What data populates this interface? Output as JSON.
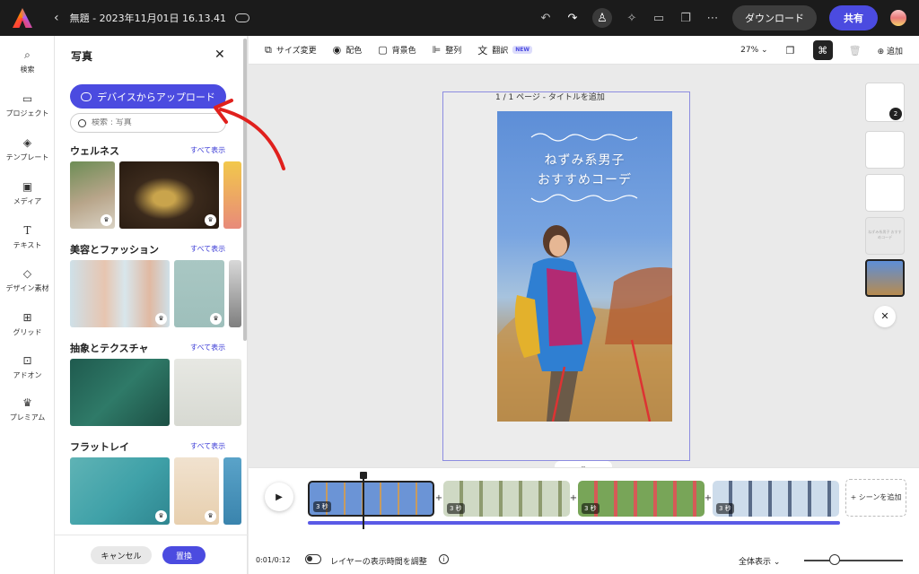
{
  "topbar": {
    "title": "無題 - 2023年11月01日 16.13.41",
    "download_label": "ダウンロード",
    "share_label": "共有"
  },
  "rail": {
    "items": [
      {
        "label": "検索",
        "icon": "search-icon"
      },
      {
        "label": "プロジェクト",
        "icon": "folder-icon"
      },
      {
        "label": "テンプレート",
        "icon": "template-icon"
      },
      {
        "label": "メディア",
        "icon": "media-icon"
      },
      {
        "label": "テキスト",
        "icon": "text-icon"
      },
      {
        "label": "デザイン素材",
        "icon": "shapes-icon"
      },
      {
        "label": "グリッド",
        "icon": "grid-icon"
      },
      {
        "label": "アドオン",
        "icon": "addon-icon"
      },
      {
        "label": "プレミアム",
        "icon": "crown-icon"
      }
    ]
  },
  "panel": {
    "title": "写真",
    "upload_label": "デバイスからアップロード",
    "search_placeholder": "検索 : 写真",
    "see_all": "すべて表示",
    "sections": [
      {
        "title": "ウェルネス"
      },
      {
        "title": "美容とファッション"
      },
      {
        "title": "抽象とテクスチャ"
      },
      {
        "title": "フラットレイ"
      }
    ],
    "cancel_label": "キャンセル",
    "replace_label": "置換"
  },
  "toolbar": {
    "resize": "サイズ変更",
    "palette": "配色",
    "background": "背景色",
    "align": "整列",
    "translate": "翻訳",
    "new_tag": "NEW",
    "zoom": "27%",
    "add": "追加"
  },
  "canvas": {
    "page_label": "1 / 1 ページ - タイトルを追加",
    "poster_title_1": "ねずみ系男子",
    "poster_title_2": "おすすめコーデ"
  },
  "pages": {
    "badge": "2",
    "mini_text": "ねずみ系男子 おすすめコーデ"
  },
  "timeline": {
    "clip_duration": "3 秒",
    "add_scene": "+ シーンを追加",
    "time": "0:01/0:12",
    "layer_toggle": "レイヤーの表示時間を調整",
    "view_all": "全体表示"
  }
}
